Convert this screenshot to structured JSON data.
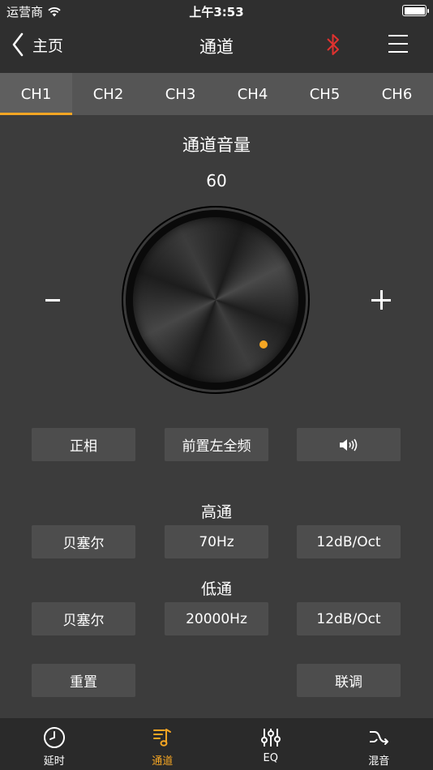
{
  "status": {
    "carrier": "运营商",
    "time": "上午3:53"
  },
  "nav": {
    "back_label": "主页",
    "title": "通道",
    "bluetooth_color": "#e0322f"
  },
  "tabs": [
    {
      "label": "CH1"
    },
    {
      "label": "CH2"
    },
    {
      "label": "CH3"
    },
    {
      "label": "CH4"
    },
    {
      "label": "CH5"
    },
    {
      "label": "CH6"
    }
  ],
  "active_tab": "CH1",
  "volume": {
    "label": "通道音量",
    "value": "60",
    "minus_label": "−",
    "plus_label": "+"
  },
  "controls": {
    "phase": "正相",
    "position": "前置左全频",
    "mute_icon": "speaker-sound-icon"
  },
  "highpass": {
    "label": "高通",
    "type": "贝塞尔",
    "freq": "70Hz",
    "slope": "12dB/Oct"
  },
  "lowpass": {
    "label": "低通",
    "type": "贝塞尔",
    "freq": "20000Hz",
    "slope": "12dB/Oct"
  },
  "actions": {
    "reset": "重置",
    "link": "联调"
  },
  "bottom_nav": [
    {
      "label": "延时",
      "icon": "clock-icon"
    },
    {
      "label": "通道",
      "icon": "music-list-icon"
    },
    {
      "label": "EQ",
      "icon": "sliders-icon"
    },
    {
      "label": "混音",
      "icon": "shuffle-icon"
    }
  ],
  "colors": {
    "accent": "#f5a623",
    "background": "#3c3c3c",
    "button": "#4d4d4d"
  }
}
